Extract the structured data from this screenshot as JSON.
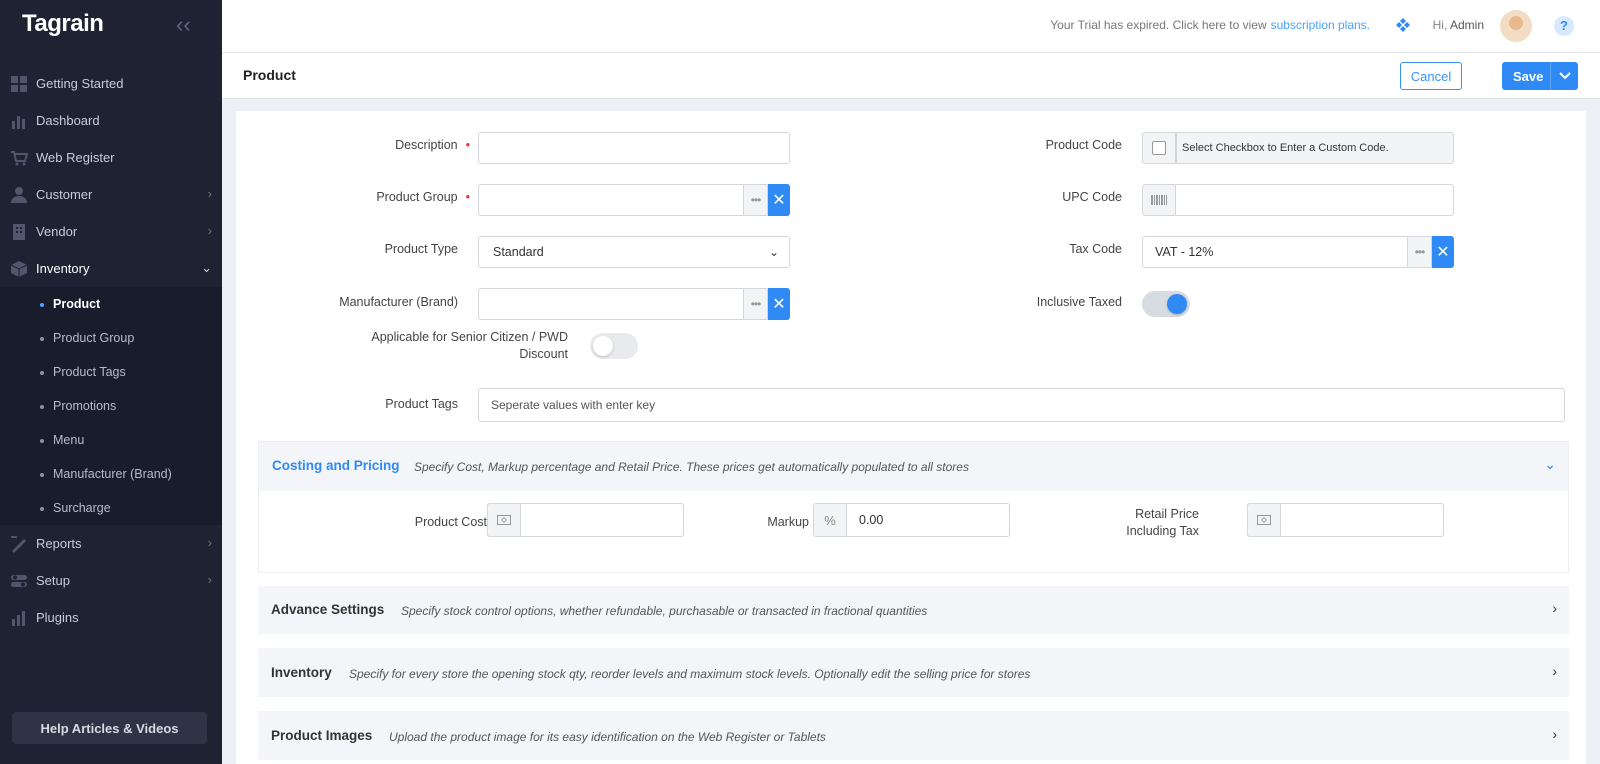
{
  "app": {
    "logo": "Tagrain"
  },
  "sidebar": {
    "items": [
      {
        "label": "Getting Started"
      },
      {
        "label": "Dashboard"
      },
      {
        "label": "Web Register"
      },
      {
        "label": "Customer"
      },
      {
        "label": "Vendor"
      },
      {
        "label": "Inventory"
      }
    ],
    "inventory_sub": [
      {
        "label": "Product"
      },
      {
        "label": "Product Group"
      },
      {
        "label": "Product Tags"
      },
      {
        "label": "Promotions"
      },
      {
        "label": "Menu"
      },
      {
        "label": "Manufacturer (Brand)"
      },
      {
        "label": "Surcharge"
      }
    ],
    "items_after": [
      {
        "label": "Reports"
      },
      {
        "label": "Setup"
      },
      {
        "label": "Plugins"
      }
    ],
    "help_button": "Help Articles & Videos"
  },
  "topbar": {
    "trial_text": "Your Trial has expired. Click here to view",
    "trial_link": "subscription plans.",
    "greeting": "Hi,",
    "user": "Admin",
    "help": "?"
  },
  "page": {
    "title": "Product",
    "cancel": "Cancel",
    "save": "Save"
  },
  "form": {
    "description_label": "Description",
    "product_group_label": "Product Group",
    "product_type_label": "Product Type",
    "product_type_value": "Standard",
    "manufacturer_label": "Manufacturer (Brand)",
    "senior_label_1": "Applicable for Senior Citizen / PWD",
    "senior_label_2": "Discount",
    "product_code_label": "Product Code",
    "product_code_hint": "Select Checkbox to Enter a Custom Code.",
    "upc_label": "UPC Code",
    "tax_code_label": "Tax Code",
    "tax_code_value": "VAT - 12%",
    "inclusive_label": "Inclusive Taxed",
    "tags_label": "Product Tags",
    "tags_placeholder": "Seperate values with enter key",
    "senior_toggle": false,
    "inclusive_toggle": true
  },
  "sections": {
    "costing": {
      "title": "Costing and Pricing",
      "desc": "Specify Cost, Markup percentage and Retail Price. These prices get automatically populated to all stores",
      "product_cost_label": "Product Cost",
      "markup_label": "Markup",
      "markup_symbol": "%",
      "markup_value": "0.00",
      "retail_label_1": "Retail Price",
      "retail_label_2": "Including Tax"
    },
    "advance": {
      "title": "Advance Settings",
      "desc": "Specify stock control options, whether refundable, purchasable or transacted in fractional quantities"
    },
    "inventory": {
      "title": "Inventory",
      "desc": "Specify for every store the opening stock qty, reorder levels and maximum stock levels. Optionally edit the selling price for stores"
    },
    "images": {
      "title": "Product Images",
      "desc": "Upload the product image for its easy identification on the Web Register or Tablets"
    }
  },
  "colors": {
    "accent": "#2f8af5",
    "sidebar": "#1e2233",
    "required": "#e4393c"
  }
}
